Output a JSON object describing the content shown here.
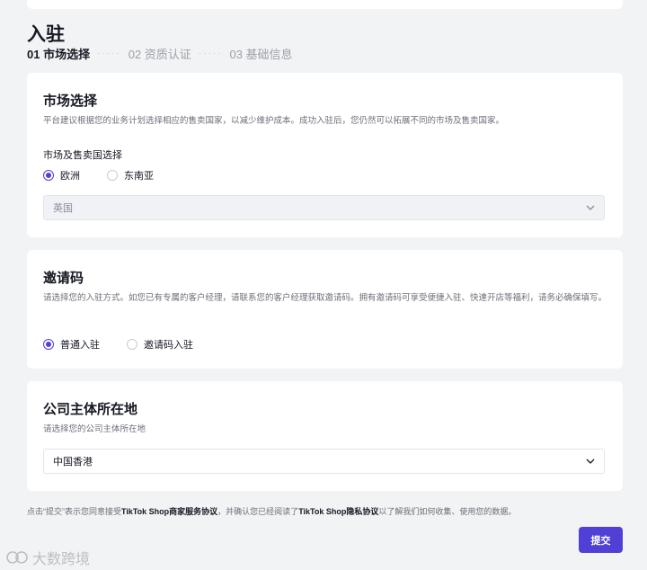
{
  "page": {
    "title": "入驻",
    "steps": [
      {
        "label": "01 市场选择",
        "active": true
      },
      {
        "label": "02 资质认证",
        "active": false
      },
      {
        "label": "03 基础信息",
        "active": false
      }
    ],
    "step_separator": "·····"
  },
  "market_card": {
    "title": "市场选择",
    "description": "平台建议根据您的业务计划选择相应的售卖国家，以减少维护成本。成功入驻后，您仍然可以拓展不同的市场及售卖国家。",
    "field_label": "市场及售卖国选择",
    "options": [
      {
        "label": "欧洲",
        "checked": true
      },
      {
        "label": "东南亚",
        "checked": false
      }
    ],
    "select_value": "英国",
    "select_icon": "chevron-down-icon"
  },
  "invite_card": {
    "title": "邀请码",
    "description": "请选择您的入驻方式。如您已有专属的客户经理，请联系您的客户经理获取邀请码。拥有邀请码可享受便捷入驻、快速开店等福利，请务必确保填写。",
    "options": [
      {
        "label": "普通入驻",
        "checked": true
      },
      {
        "label": "邀请码入驻",
        "checked": false
      }
    ]
  },
  "company_card": {
    "title": "公司主体所在地",
    "description": "请选择您的公司主体所在地",
    "select_value": "中国香港",
    "select_icon": "chevron-down-icon"
  },
  "footer": {
    "note_prefix": "点击“提交”表示您同意接受",
    "link1": "TikTok Shop商家服务协议",
    "note_middle": "，并确认您已经阅读了",
    "link2": "TikTok Shop隐私协议",
    "note_suffix": "以了解我们如何收集、使用您的数据。",
    "submit_label": "提交"
  },
  "watermark": {
    "text": "大数跨境"
  },
  "colors": {
    "accent": "#5040d6",
    "background": "#f2f3f5",
    "card": "#ffffff"
  }
}
